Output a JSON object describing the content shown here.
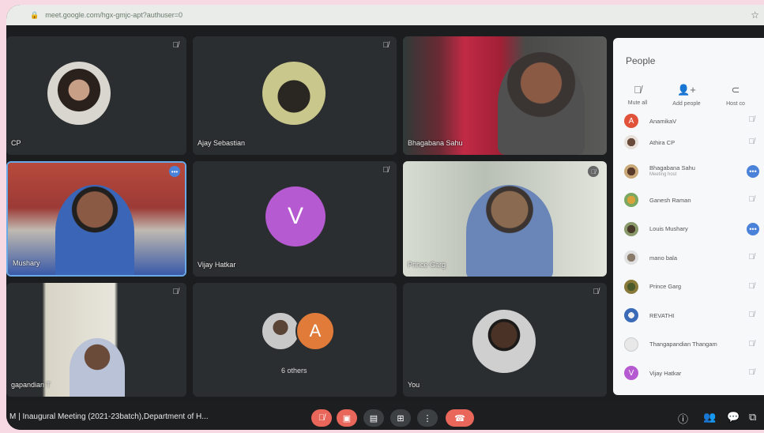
{
  "browser": {
    "url": "meet.google.com/hgx-gmjc-apt?authuser=0"
  },
  "tiles": [
    {
      "name": "CP",
      "muted": true
    },
    {
      "name": "Ajay Sebastian",
      "muted": true
    },
    {
      "name": "Bhagabana Sahu",
      "muted": false
    },
    {
      "name": "Mushary",
      "muted": false
    },
    {
      "name": "Vijay Hatkar",
      "muted": true,
      "letter": "V"
    },
    {
      "name": "Prince Garg",
      "muted": true
    },
    {
      "name": "gapandian T",
      "muted": true
    },
    {
      "name": "6 others",
      "letter": "A"
    },
    {
      "name": "You",
      "muted": true
    }
  ],
  "people_panel": {
    "title": "People",
    "actions": [
      {
        "label": "Mute all",
        "icon": "mic-off-icon"
      },
      {
        "label": "Add people",
        "icon": "add-person-icon"
      },
      {
        "label": "Host co",
        "icon": "host-controls-icon"
      }
    ],
    "participants": [
      {
        "name": "AnamikaV",
        "sub": "",
        "letter": "A",
        "color": "#e0533a"
      },
      {
        "name": "Athira CP",
        "sub": "",
        "letter": ""
      },
      {
        "name": "Bhagabana Sahu",
        "sub": "Meeting host",
        "letter": ""
      },
      {
        "name": "Ganesh Raman",
        "sub": "",
        "letter": ""
      },
      {
        "name": "Louis Mushary",
        "sub": "",
        "letter": ""
      },
      {
        "name": "mano bala",
        "sub": "",
        "letter": ""
      },
      {
        "name": "Prince Garg",
        "sub": "",
        "letter": ""
      },
      {
        "name": "REVATHI",
        "sub": "",
        "letter": ""
      },
      {
        "name": "Thangapandian Thangam",
        "sub": "",
        "letter": ""
      },
      {
        "name": "Vijay Hatkar",
        "sub": "",
        "letter": "V",
        "color": "#b55ad0"
      }
    ]
  },
  "bottom_bar": {
    "meeting_title": "M  |  Inaugural Meeting (2021-23batch),Department of H..."
  },
  "colors": {
    "letter_v": "#b55ad0",
    "letter_a": "#e07b3a",
    "end_call": "#e8665a",
    "active_speaker_border": "#6aa9e8"
  }
}
